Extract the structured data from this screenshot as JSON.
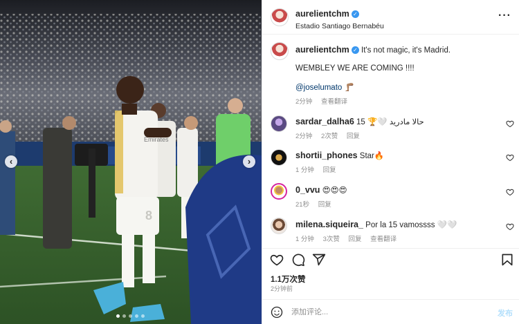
{
  "post": {
    "author": "aurelientchm",
    "location": "Estadio Santiago Bernabéu"
  },
  "caption": {
    "username": "aurelientchm",
    "line1": "It's not magic, it's Madrid.",
    "line2": "WEMBLEY WE ARE COMING !!!!",
    "mention": "@joselumato",
    "mention_emoji": "🦵🏽",
    "time": "2分钟",
    "translate": "查看翻译"
  },
  "comments": [
    {
      "username": "sardar_dalha6",
      "text": "15 🏆🤍 حالا مادريد",
      "time": "2分钟",
      "likes": "2次赞",
      "reply": "回复",
      "translate": ""
    },
    {
      "username": "shortii_phones",
      "text": "Star🔥",
      "time": "1 分钟",
      "likes": "",
      "reply": "回复",
      "translate": ""
    },
    {
      "username": "0_vvu",
      "text": "😍😍😍",
      "time": "21秒",
      "likes": "",
      "reply": "回复",
      "translate": ""
    },
    {
      "username": "milena.siqueira_",
      "text": "Por la 15 vamossss 🤍🤍",
      "time": "1 分钟",
      "likes": "3次赞",
      "reply": "回复",
      "translate": "查看翻译"
    }
  ],
  "actions": {
    "likes": "1.1万次赞",
    "posted": "2分钟前"
  },
  "comment_box": {
    "placeholder": "添加评论...",
    "post_label": "发布"
  },
  "media": {
    "jersey_number": "8",
    "sponsor": "Emirates"
  },
  "icons": {
    "verified": "verified-badge-icon",
    "more": "more-options-icon",
    "heart": "heart-icon",
    "comment": "comment-icon",
    "share": "share-icon",
    "save": "bookmark-icon",
    "emoji": "emoji-icon"
  },
  "colors": {
    "verified_blue": "#3897f0",
    "mention_blue": "#00376b",
    "meta_gray": "#8e8e8e",
    "post_button_blue": "#b2dffc"
  }
}
